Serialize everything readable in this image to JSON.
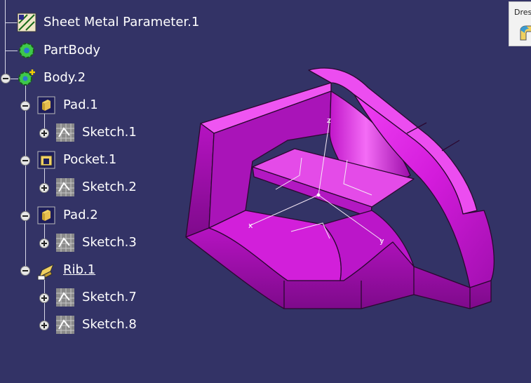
{
  "tree": {
    "items": [
      {
        "label": "Sheet Metal Parameter.1",
        "icon": "sheet-metal-parameter-icon"
      },
      {
        "label": "PartBody",
        "icon": "partbody-gear-icon"
      },
      {
        "label": "Body.2",
        "icon": "body-gear-icon",
        "expander": "minus"
      },
      {
        "label": "Pad.1",
        "icon": "pad-icon",
        "expander": "minus"
      },
      {
        "label": "Sketch.1",
        "icon": "sketch-icon",
        "expander": "plus"
      },
      {
        "label": "Pocket.1",
        "icon": "pocket-icon",
        "expander": "minus"
      },
      {
        "label": "Sketch.2",
        "icon": "sketch-icon",
        "expander": "plus"
      },
      {
        "label": "Pad.2",
        "icon": "pad-icon",
        "expander": "minus"
      },
      {
        "label": "Sketch.3",
        "icon": "sketch-icon",
        "expander": "plus"
      },
      {
        "label": "Rib.1",
        "icon": "rib-icon",
        "expander": "minus",
        "underlined": true
      },
      {
        "label": "Sketch.7",
        "icon": "sketch-icon",
        "expander": "plus"
      },
      {
        "label": "Sketch.8",
        "icon": "sketch-icon",
        "expander": "plus"
      }
    ]
  },
  "toolbar": {
    "title": "Dres",
    "icon": "dress-up-fillet-icon"
  },
  "model": {
    "body_color": "#d91ee0",
    "axis_labels": {
      "x": "x",
      "y": "y",
      "z": "z"
    }
  },
  "colors": {
    "background": "#333366",
    "tree_text": "#ffffff"
  }
}
